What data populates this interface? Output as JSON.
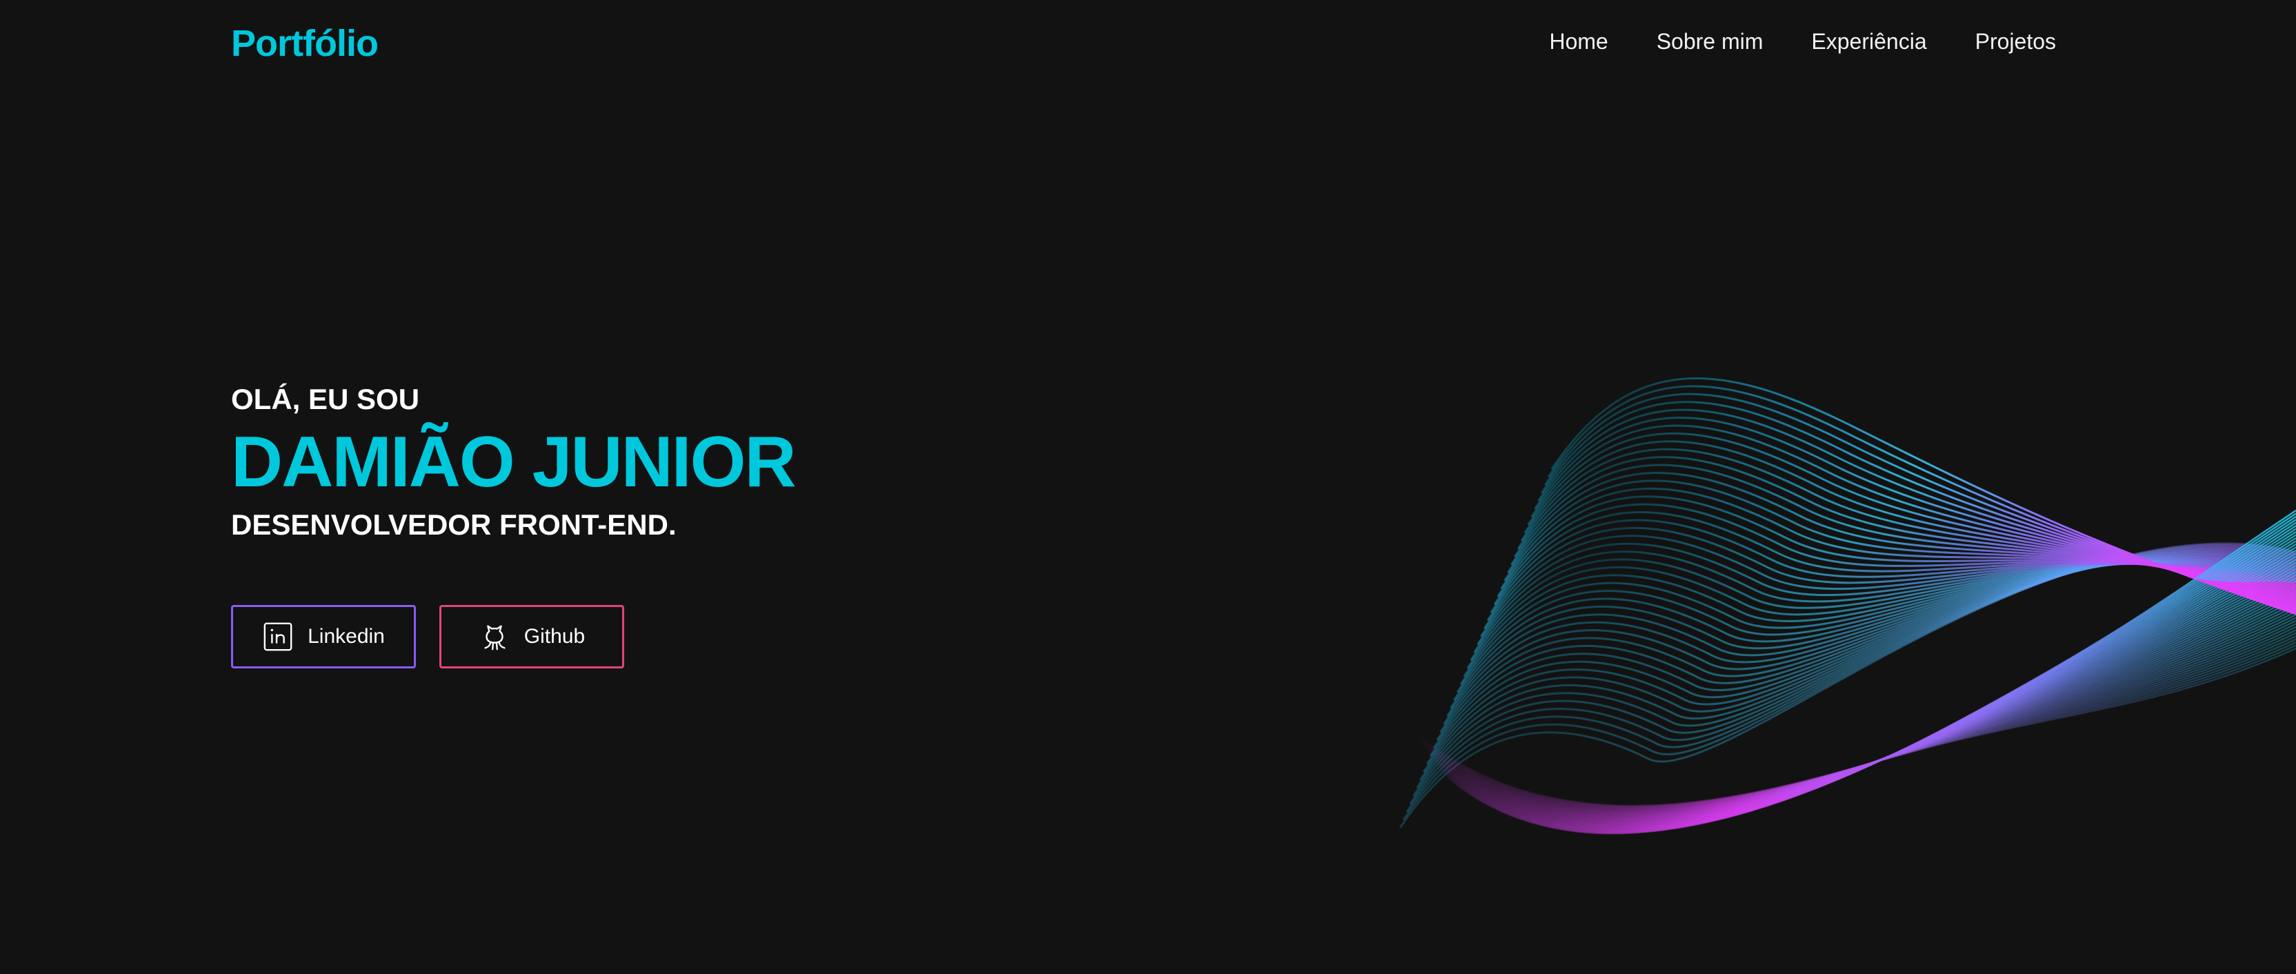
{
  "header": {
    "logo": "Portfólio",
    "nav": [
      {
        "label": "Home"
      },
      {
        "label": "Sobre mim"
      },
      {
        "label": "Experiência"
      },
      {
        "label": "Projetos"
      }
    ]
  },
  "hero": {
    "greeting": "OLÁ, EU SOU",
    "name": "DAMIÃO JUNIOR",
    "role": "DESENVOLVEDOR FRONT-END.",
    "buttons": {
      "linkedin": {
        "label": "Linkedin",
        "icon": "linkedin-icon"
      },
      "github": {
        "label": "Github",
        "icon": "github-icon"
      }
    }
  },
  "colors": {
    "background": "#121212",
    "accent": "#00c8dc",
    "linkedin_border": "#8a5cf6",
    "github_border": "#e0457b",
    "wave_start": "#00d4ff",
    "wave_end": "#e040fb"
  }
}
